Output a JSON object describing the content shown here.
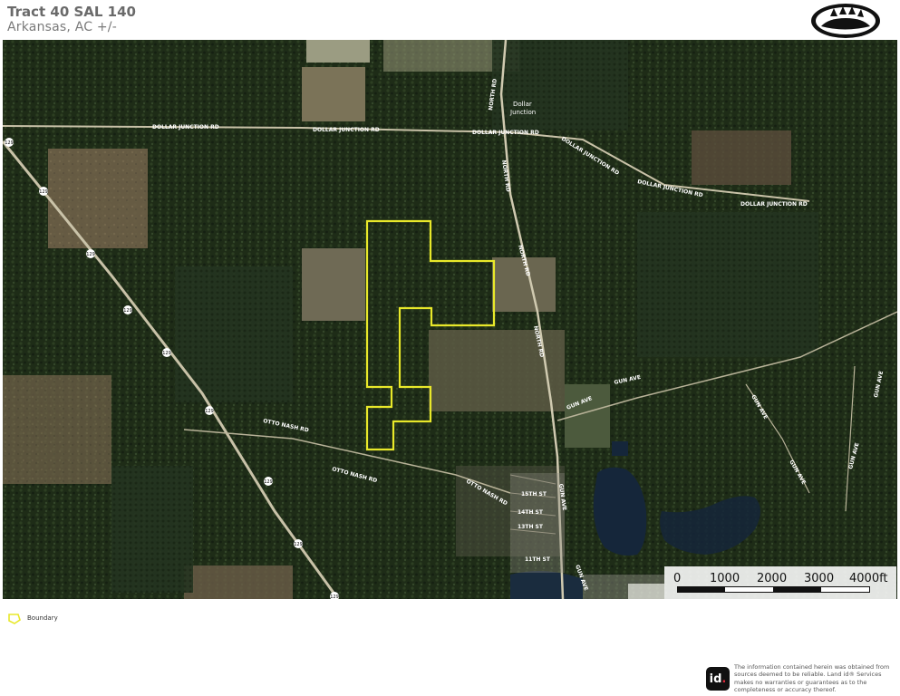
{
  "header": {
    "title": "Tract 40 SAL 140",
    "subtitle": "Arkansas,  AC +/-"
  },
  "map": {
    "place_labels": {
      "dollar_junction_line1": "Dollar",
      "dollar_junction_line2": "Junction"
    },
    "road_labels": {
      "dollar_junction_rd": "DOLLAR JUNCTION RD",
      "north_rd": "NORTH RD",
      "otto_nash_rd": "OTTO NASH RD",
      "gun_ave": "GUN AVE",
      "street_15th": "15TH ST",
      "street_14th": "14TH ST",
      "street_13th": "13TH ST",
      "street_11th": "11TH ST",
      "highway_129": "129"
    },
    "boundary_color": "#e8e82a",
    "road_label_color": "#ffffff"
  },
  "scale_bar": {
    "labels": [
      "0",
      "1000",
      "2000",
      "3000",
      "4000ft"
    ]
  },
  "legend": {
    "boundary_label": "Boundary"
  },
  "footer": {
    "logo_text": "id",
    "disclaimer": "The information contained herein was obtained from sources deemed to be reliable. Land id® Services makes no warranties or guarantees as to the completeness or accuracy thereof."
  }
}
